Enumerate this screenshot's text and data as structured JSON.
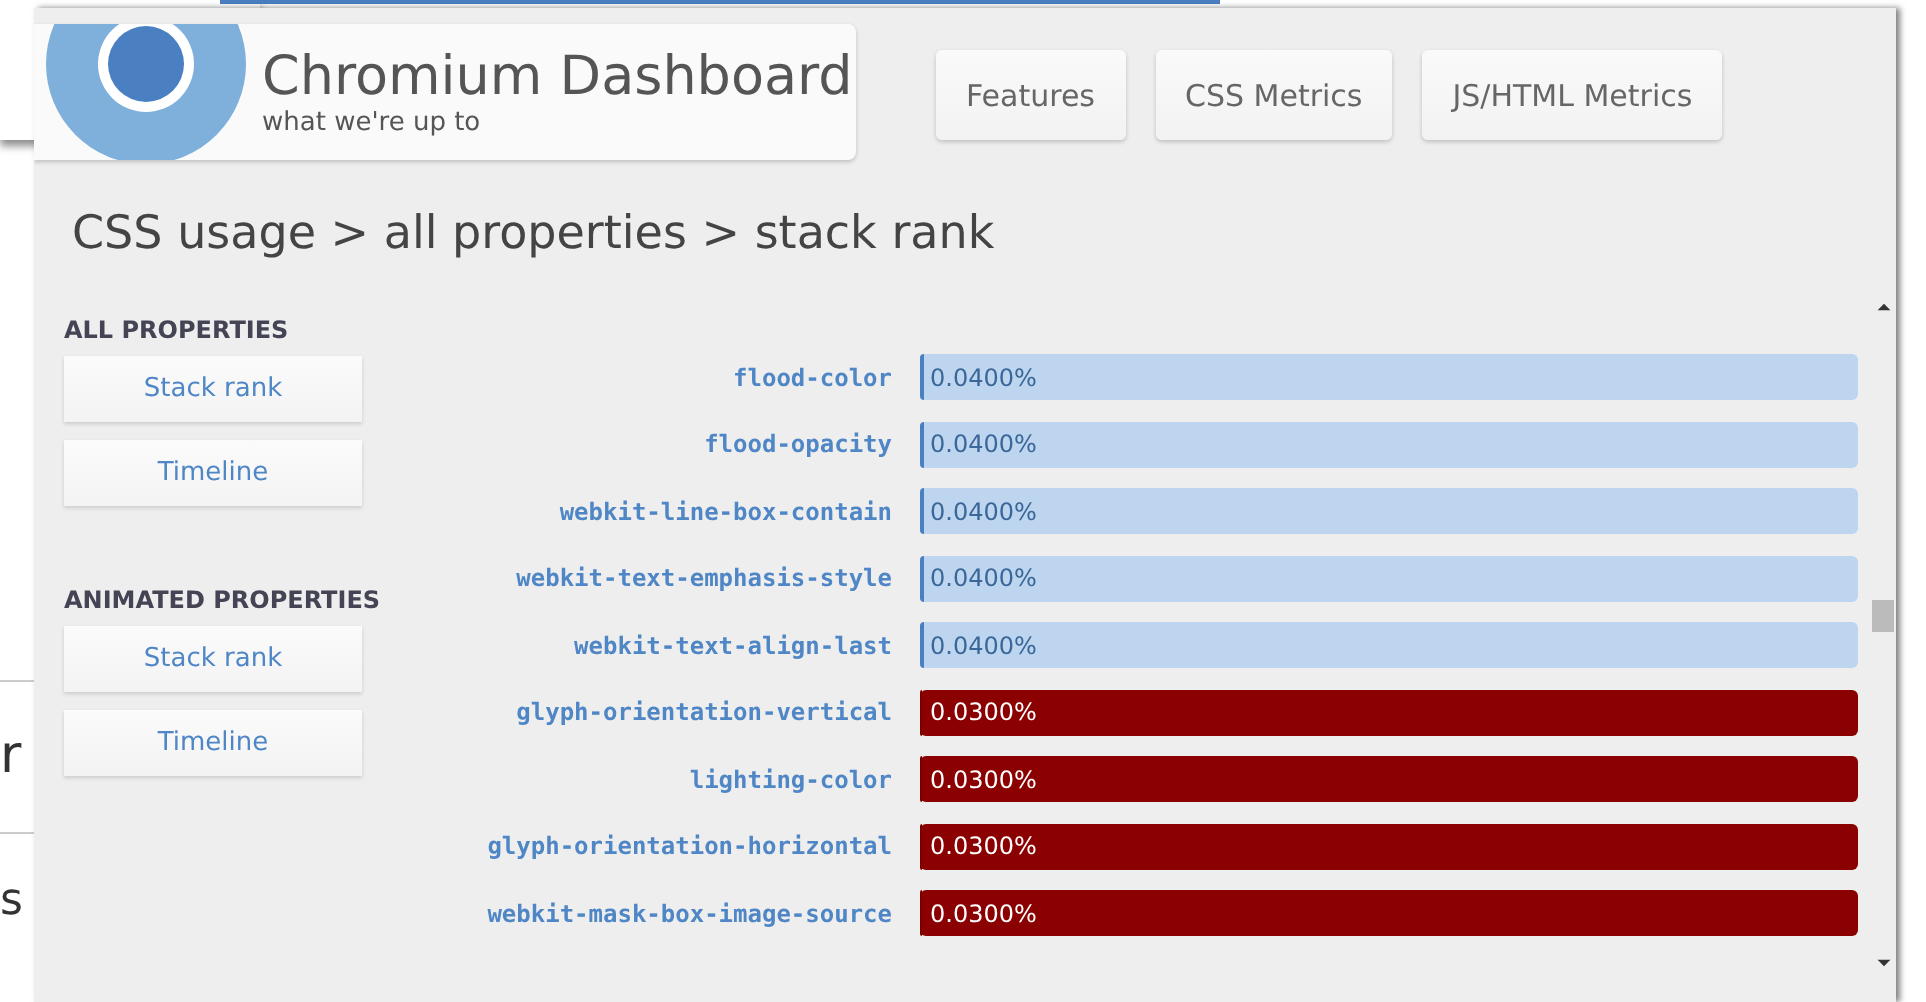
{
  "background_window": {
    "texts": [
      "r",
      "s"
    ]
  },
  "header": {
    "title": "Chromium Dashboard",
    "subtitle": "what we're up to"
  },
  "nav": [
    {
      "label": "Features"
    },
    {
      "label": "CSS Metrics"
    },
    {
      "label": "JS/HTML Metrics"
    }
  ],
  "heading": "CSS usage > all properties > stack rank",
  "sidebar": [
    {
      "title": "ALL PROPERTIES",
      "items": [
        {
          "label": "Stack rank"
        },
        {
          "label": "Timeline"
        }
      ]
    },
    {
      "title": "ANIMATED PROPERTIES",
      "items": [
        {
          "label": "Stack rank"
        },
        {
          "label": "Timeline"
        }
      ]
    }
  ],
  "rows": [
    {
      "property": "flood-color",
      "reading": "0.0400%",
      "level": 0.004,
      "obsolete": false
    },
    {
      "property": "flood-opacity",
      "reading": "0.0400%",
      "level": 0.004,
      "obsolete": false
    },
    {
      "property": "webkit-line-box-contain",
      "reading": "0.0400%",
      "level": 0.004,
      "obsolete": false
    },
    {
      "property": "webkit-text-emphasis-style",
      "reading": "0.0400%",
      "level": 0.004,
      "obsolete": false
    },
    {
      "property": "webkit-text-align-last",
      "reading": "0.0400%",
      "level": 0.004,
      "obsolete": false
    },
    {
      "property": "glyph-orientation-vertical",
      "reading": "0.0300%",
      "level": 0.003,
      "obsolete": true
    },
    {
      "property": "lighting-color",
      "reading": "0.0300%",
      "level": 0.003,
      "obsolete": true
    },
    {
      "property": "glyph-orientation-horizontal",
      "reading": "0.0300%",
      "level": 0.003,
      "obsolete": true
    },
    {
      "property": "webkit-mask-box-image-source",
      "reading": "0.0300%",
      "level": 0.003,
      "obsolete": true
    }
  ]
}
